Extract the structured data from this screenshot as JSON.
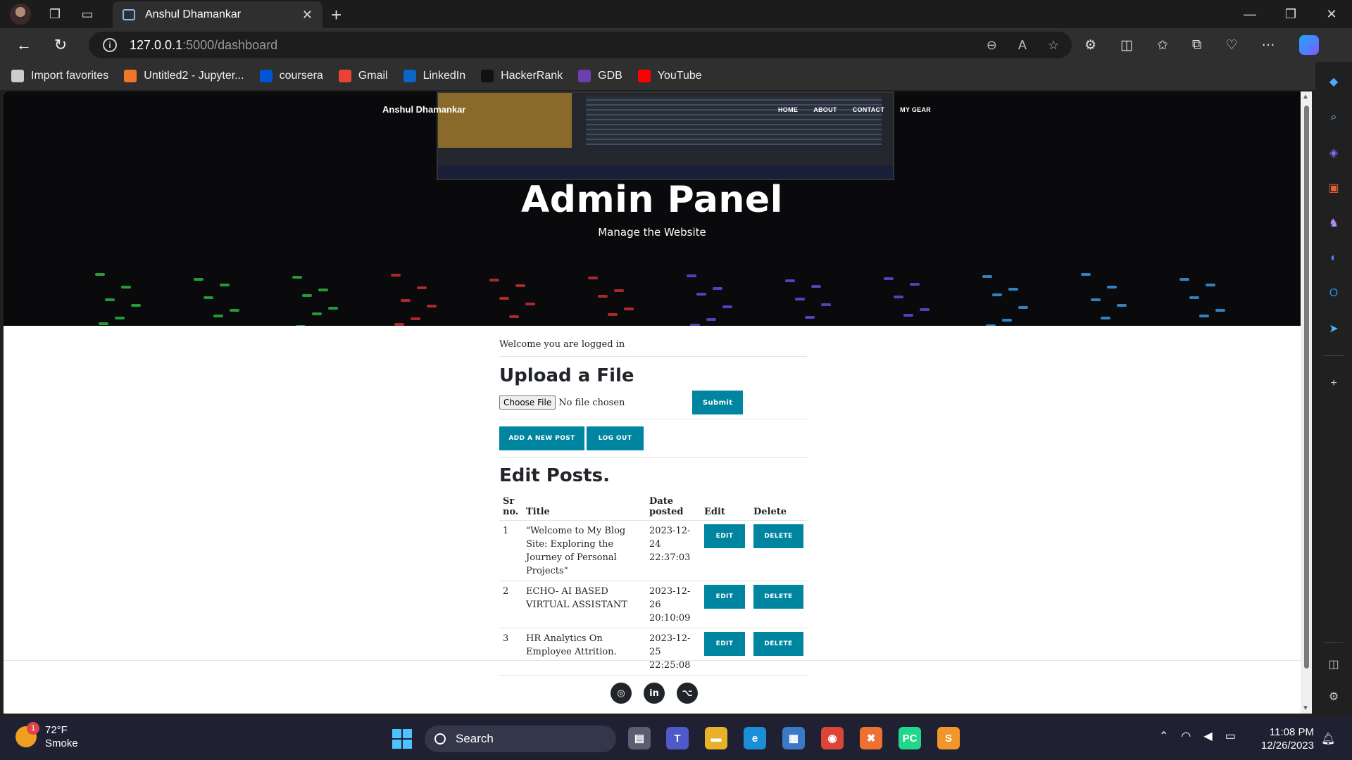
{
  "browser": {
    "tab_title": "Anshul Dhamankar",
    "url_host": "127.0.0.1",
    "url_path": ":5000/dashboard",
    "favorites": [
      {
        "label": "Import favorites",
        "icon": "import-icon",
        "color": "#cccccc"
      },
      {
        "label": "Untitled2 - Jupyter...",
        "icon": "jupyter-icon",
        "color": "#f37626"
      },
      {
        "label": "coursera",
        "icon": "coursera-icon",
        "color": "#0056d2"
      },
      {
        "label": "Gmail",
        "icon": "gmail-icon",
        "color": "#ea4335"
      },
      {
        "label": "LinkedIn",
        "icon": "linkedin-icon",
        "color": "#0a66c2"
      },
      {
        "label": "HackerRank",
        "icon": "hackerrank-icon",
        "color": "#111111"
      },
      {
        "label": "GDB",
        "icon": "gdb-icon",
        "color": "#6b3fb0"
      },
      {
        "label": "YouTube",
        "icon": "youtube-icon",
        "color": "#ff0000"
      }
    ]
  },
  "site": {
    "brand": "Anshul Dhamankar",
    "nav": [
      "HOME",
      "ABOUT",
      "CONTACT",
      "MY GEAR"
    ],
    "hero_title": "Admin Panel",
    "hero_subtitle": "Manage the Website",
    "accent_color": "#0085a1"
  },
  "dashboard": {
    "welcome": "Welcome you are logged in",
    "upload_title": "Upload a File",
    "choose_file_label": "Choose File",
    "no_file_text": "No file chosen",
    "submit_label": "Submit",
    "add_post_label": "ADD A NEW POST",
    "logout_label": "LOG OUT",
    "edit_title": "Edit Posts.",
    "columns": [
      "Sr no.",
      "Title",
      "Date posted",
      "Edit",
      "Delete"
    ],
    "posts": [
      {
        "sr": "1",
        "title": "\"Welcome to My Blog Site: Exploring the Journey of Personal Projects\"",
        "date": "2023-12-24 22:37:03",
        "edit": "EDIT",
        "delete": "DELETE"
      },
      {
        "sr": "2",
        "title": "ECHO- AI BASED VIRTUAL ASSISTANT",
        "date": "2023-12-26 20:10:09",
        "edit": "EDIT",
        "delete": "DELETE"
      },
      {
        "sr": "3",
        "title": "HR Analytics On Employee Attrition.",
        "date": "2023-12-25 22:25:08",
        "edit": "EDIT",
        "delete": "DELETE"
      }
    ]
  },
  "taskbar": {
    "weather_badge": "1",
    "temperature": "72°F",
    "condition": "Smoke",
    "search_label": "Search",
    "time": "11:08 PM",
    "date": "12/26/2023"
  }
}
